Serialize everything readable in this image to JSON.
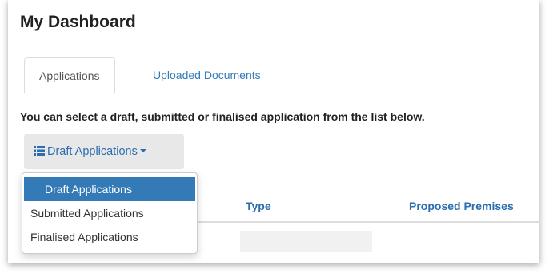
{
  "page": {
    "title": "My Dashboard"
  },
  "tabs": [
    {
      "label": "Applications",
      "active": true
    },
    {
      "label": "Uploaded Documents",
      "active": false
    }
  ],
  "instruction": "You can select a draft, submitted or finalised application from the list below.",
  "dropdown": {
    "label": "Draft Applications",
    "icon": "list-icon",
    "options": [
      {
        "label": "Draft Applications",
        "selected": true
      },
      {
        "label": "Submitted Applications",
        "selected": false
      },
      {
        "label": "Finalised Applications",
        "selected": false
      }
    ]
  },
  "table": {
    "columns": [
      "Type",
      "Proposed Premises"
    ]
  },
  "colors": {
    "link": "#337ab7",
    "active_bg": "#337ab7",
    "button_bg": "#e8e8e8"
  }
}
